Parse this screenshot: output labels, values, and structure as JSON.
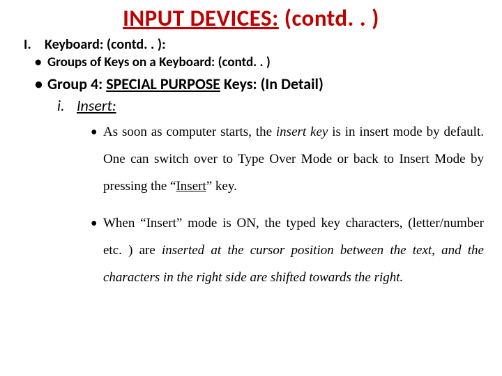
{
  "title": {
    "pre": "INPUT DEVICES:",
    "suffix": " (contd. . )"
  },
  "roman": {
    "num": "I.",
    "text": "Keyboard: (contd. . ):"
  },
  "sub1": {
    "bullet": "•",
    "text": "Groups of Keys on a Keyboard: (contd. . )"
  },
  "sub2": {
    "bullet": "•",
    "seg1": "Group 4:   ",
    "special": "SPECIAL PURPOSE",
    "seg2": " Keys: (In Detail)"
  },
  "item": {
    "num": "i.",
    "label": "Insert:"
  },
  "paras": {
    "p1": {
      "bullet": "•",
      "a": "As soon as computer starts, the ",
      "b": "insert key",
      "c": " is in insert mode by default. One can switch over to Type Over Mode or back to Insert Mode by pressing the “",
      "d": "Insert",
      "e": "” key."
    },
    "p2": {
      "bullet": "•",
      "a": "When “Insert” mode is ON, the typed key characters, (letter/number etc. ) are ",
      "b": "inserted at the cursor position between the text, and the characters in the right side are shifted towards the right."
    }
  }
}
